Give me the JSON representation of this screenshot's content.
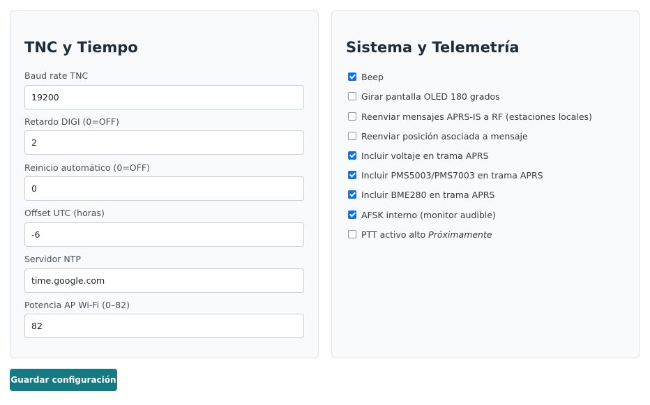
{
  "tnc_section": {
    "title": "TNC y Tiempo",
    "fields": [
      {
        "label": "Baud rate TNC",
        "value": "19200"
      },
      {
        "label": "Retardo DIGI (0=OFF)",
        "value": "2"
      },
      {
        "label": "Reinicio automático (0=OFF)",
        "value": "0"
      },
      {
        "label": "Offset UTC (horas)",
        "value": "-6"
      },
      {
        "label": "Servidor NTP",
        "value": "time.google.com"
      },
      {
        "label": "Potencia AP Wi-Fi (0–82)",
        "value": "82"
      }
    ]
  },
  "system_section": {
    "title": "Sistema y Telemetría",
    "options": [
      {
        "label": "Beep",
        "checked": true
      },
      {
        "label": "Girar pantalla OLED 180 grados",
        "checked": false
      },
      {
        "label": "Reenviar mensajes APRS-IS a RF (estaciones locales)",
        "checked": false
      },
      {
        "label": "Reenviar posición asociada a mensaje",
        "checked": false
      },
      {
        "label": "Incluir voltaje en trama APRS",
        "checked": true
      },
      {
        "label": "Incluir PMS5003/PMS7003 en trama APRS",
        "checked": true
      },
      {
        "label": "Incluir BME280 en trama APRS",
        "checked": true
      },
      {
        "label": "AFSK interno (monitor audible)",
        "checked": true
      },
      {
        "label": "PTT activo alto",
        "checked": false,
        "note": "Próximamente"
      }
    ]
  },
  "actions": {
    "save_label": "Guardar configuración"
  },
  "colors": {
    "accent_button": "#167a85",
    "checkbox_checked": "#0b6ffd",
    "card_background": "#f8fafb"
  }
}
